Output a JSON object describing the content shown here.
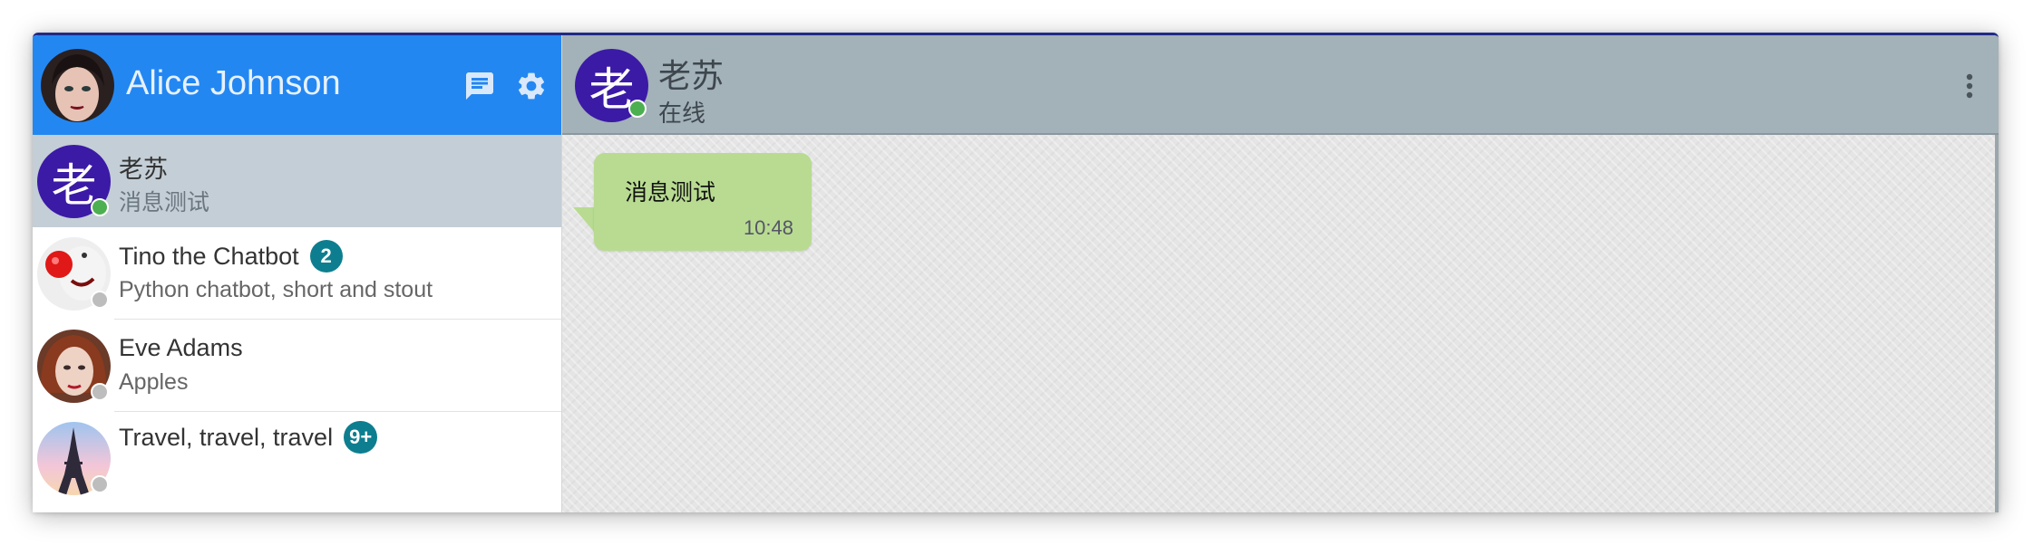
{
  "user": {
    "name": "Alice Johnson"
  },
  "header_icons": {
    "new_chat": "chat-icon",
    "settings": "gear-icon"
  },
  "contacts": [
    {
      "title": "老苏",
      "subtitle": "消息测试",
      "avatar_letter": "老",
      "online": true,
      "selected": true,
      "badge": ""
    },
    {
      "title": "Tino the Chatbot",
      "subtitle": "Python chatbot, short and stout",
      "online": false,
      "selected": false,
      "badge": "2"
    },
    {
      "title": "Eve Adams",
      "subtitle": "Apples",
      "online": false,
      "selected": false,
      "badge": ""
    },
    {
      "title": "Travel, travel, travel",
      "subtitle": "",
      "online": false,
      "selected": false,
      "badge": "9+"
    }
  ],
  "chat": {
    "title": "老苏",
    "avatar_letter": "老",
    "status": "在线",
    "messages": [
      {
        "text": "消息测试",
        "time": "10:48",
        "direction": "incoming"
      }
    ]
  },
  "colors": {
    "sidebar_header": "#2387f2",
    "chat_header": "#a3b1b8",
    "selected_row": "#c4ced6",
    "avatar_letter_bg": "#3b1aa6",
    "online": "#4caf50",
    "offline": "#bdbdbd",
    "badge": "#0d7e8f",
    "bubble": "#b8db91"
  }
}
